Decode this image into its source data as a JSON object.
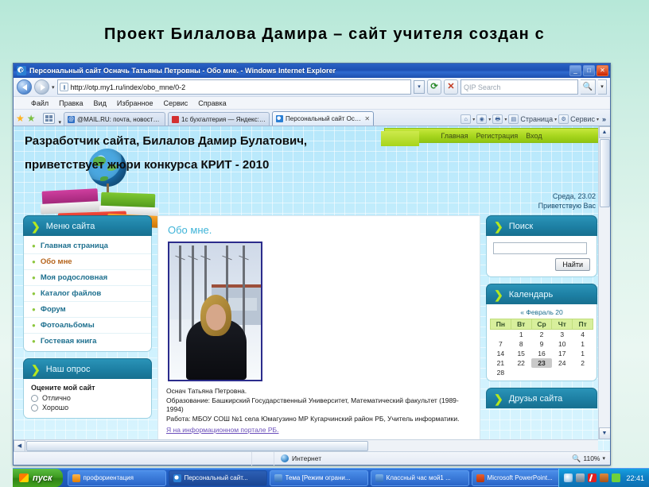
{
  "slide": {
    "title": "Проект Билалова Дамира – сайт учителя создан с"
  },
  "browser": {
    "title": "Персональный сайт Осначь Татьяны Петровны - Обо мне. - Windows Internet Explorer",
    "window_buttons": {
      "minimize": "_",
      "maximize": "□",
      "close": "✕"
    },
    "url": "http://otp.my1.ru/index/obo_mne/0-2",
    "search_placeholder": "QIP Search",
    "menu": [
      "Файл",
      "Правка",
      "Вид",
      "Избранное",
      "Сервис",
      "Справка"
    ],
    "tabs": [
      {
        "label": "@MAIL.RU: почта, новости...",
        "active": false
      },
      {
        "label": "1с бухгалтерия — Яндекс: ...",
        "active": false
      },
      {
        "label": "Персональный сайт Осн...",
        "active": true,
        "close": "✕"
      }
    ],
    "toolbar_right": [
      {
        "label": "Страница"
      },
      {
        "label": "Сервис"
      }
    ],
    "toolbar_chevron": "»",
    "status": {
      "zone": "Интернет",
      "zoom": "110%"
    }
  },
  "overlay": {
    "line1": "Разработчик сайта, Билалов Дамир Булатович,",
    "line2": "приветствует жюри конкурса КРИТ - 2010"
  },
  "site": {
    "topnav": [
      "Главная",
      "Регистрация",
      "Вход"
    ],
    "date_line1": "Среда, 23.02",
    "date_line2": "Приветствую Вас",
    "menu_block": {
      "title": "Меню сайта",
      "items": [
        {
          "label": "Главная страница",
          "current": false
        },
        {
          "label": "Обо мне",
          "current": true
        },
        {
          "label": "Моя родословная",
          "current": false
        },
        {
          "label": "Каталог файлов",
          "current": false
        },
        {
          "label": "Форум",
          "current": false
        },
        {
          "label": "Фотоальбомы",
          "current": false
        },
        {
          "label": "Гостевая книга",
          "current": false
        }
      ]
    },
    "poll_block": {
      "title": "Наш опрос",
      "question": "Оцените мой сайт",
      "options": [
        "Отлично",
        "Хорошо"
      ]
    },
    "main": {
      "heading": "Обо мне.",
      "name": "Оснач Татьяна Петровна.",
      "education": "Образование: Башкирский Государственный Университет, Математический факультет (1989-1994)",
      "work": "Работа: МБОУ СОШ №1 села Юмагузино МР Кугарчинский район РБ, Учитель информатики.",
      "link": "Я на информационном портале РБ."
    },
    "search_block": {
      "title": "Поиск",
      "input_value": "",
      "button": "Найти"
    },
    "calendar_block": {
      "title": "Календарь",
      "prev": "«",
      "month": "Февраль 20",
      "weekdays": [
        "Пн",
        "Вт",
        "Ср",
        "Чт",
        "Пт"
      ],
      "weeks": [
        [
          "",
          "1",
          "2",
          "3",
          "4"
        ],
        [
          "7",
          "8",
          "9",
          "10",
          "1"
        ],
        [
          "14",
          "15",
          "16",
          "17",
          "1"
        ],
        [
          "21",
          "22",
          "23",
          "24",
          "2"
        ],
        [
          "28",
          "",
          "",
          "",
          ""
        ]
      ],
      "today": "23"
    },
    "friends_block": {
      "title": "Друзья сайта"
    }
  },
  "taskbar": {
    "start": "пуск",
    "tasks": [
      {
        "label": "профориентация",
        "icon": "folder-icon",
        "active": false
      },
      {
        "label": "Персональный сайт...",
        "icon": "ie-icon",
        "active": true
      },
      {
        "label": "Тема [Режим ограни...",
        "icon": "word-icon",
        "active": false
      },
      {
        "label": "Классный час мой1 ...",
        "icon": "word-icon",
        "active": false
      },
      {
        "label": "Microsoft PowerPoint...",
        "icon": "powerpoint-icon",
        "active": false
      }
    ],
    "clock": "22:41"
  }
}
